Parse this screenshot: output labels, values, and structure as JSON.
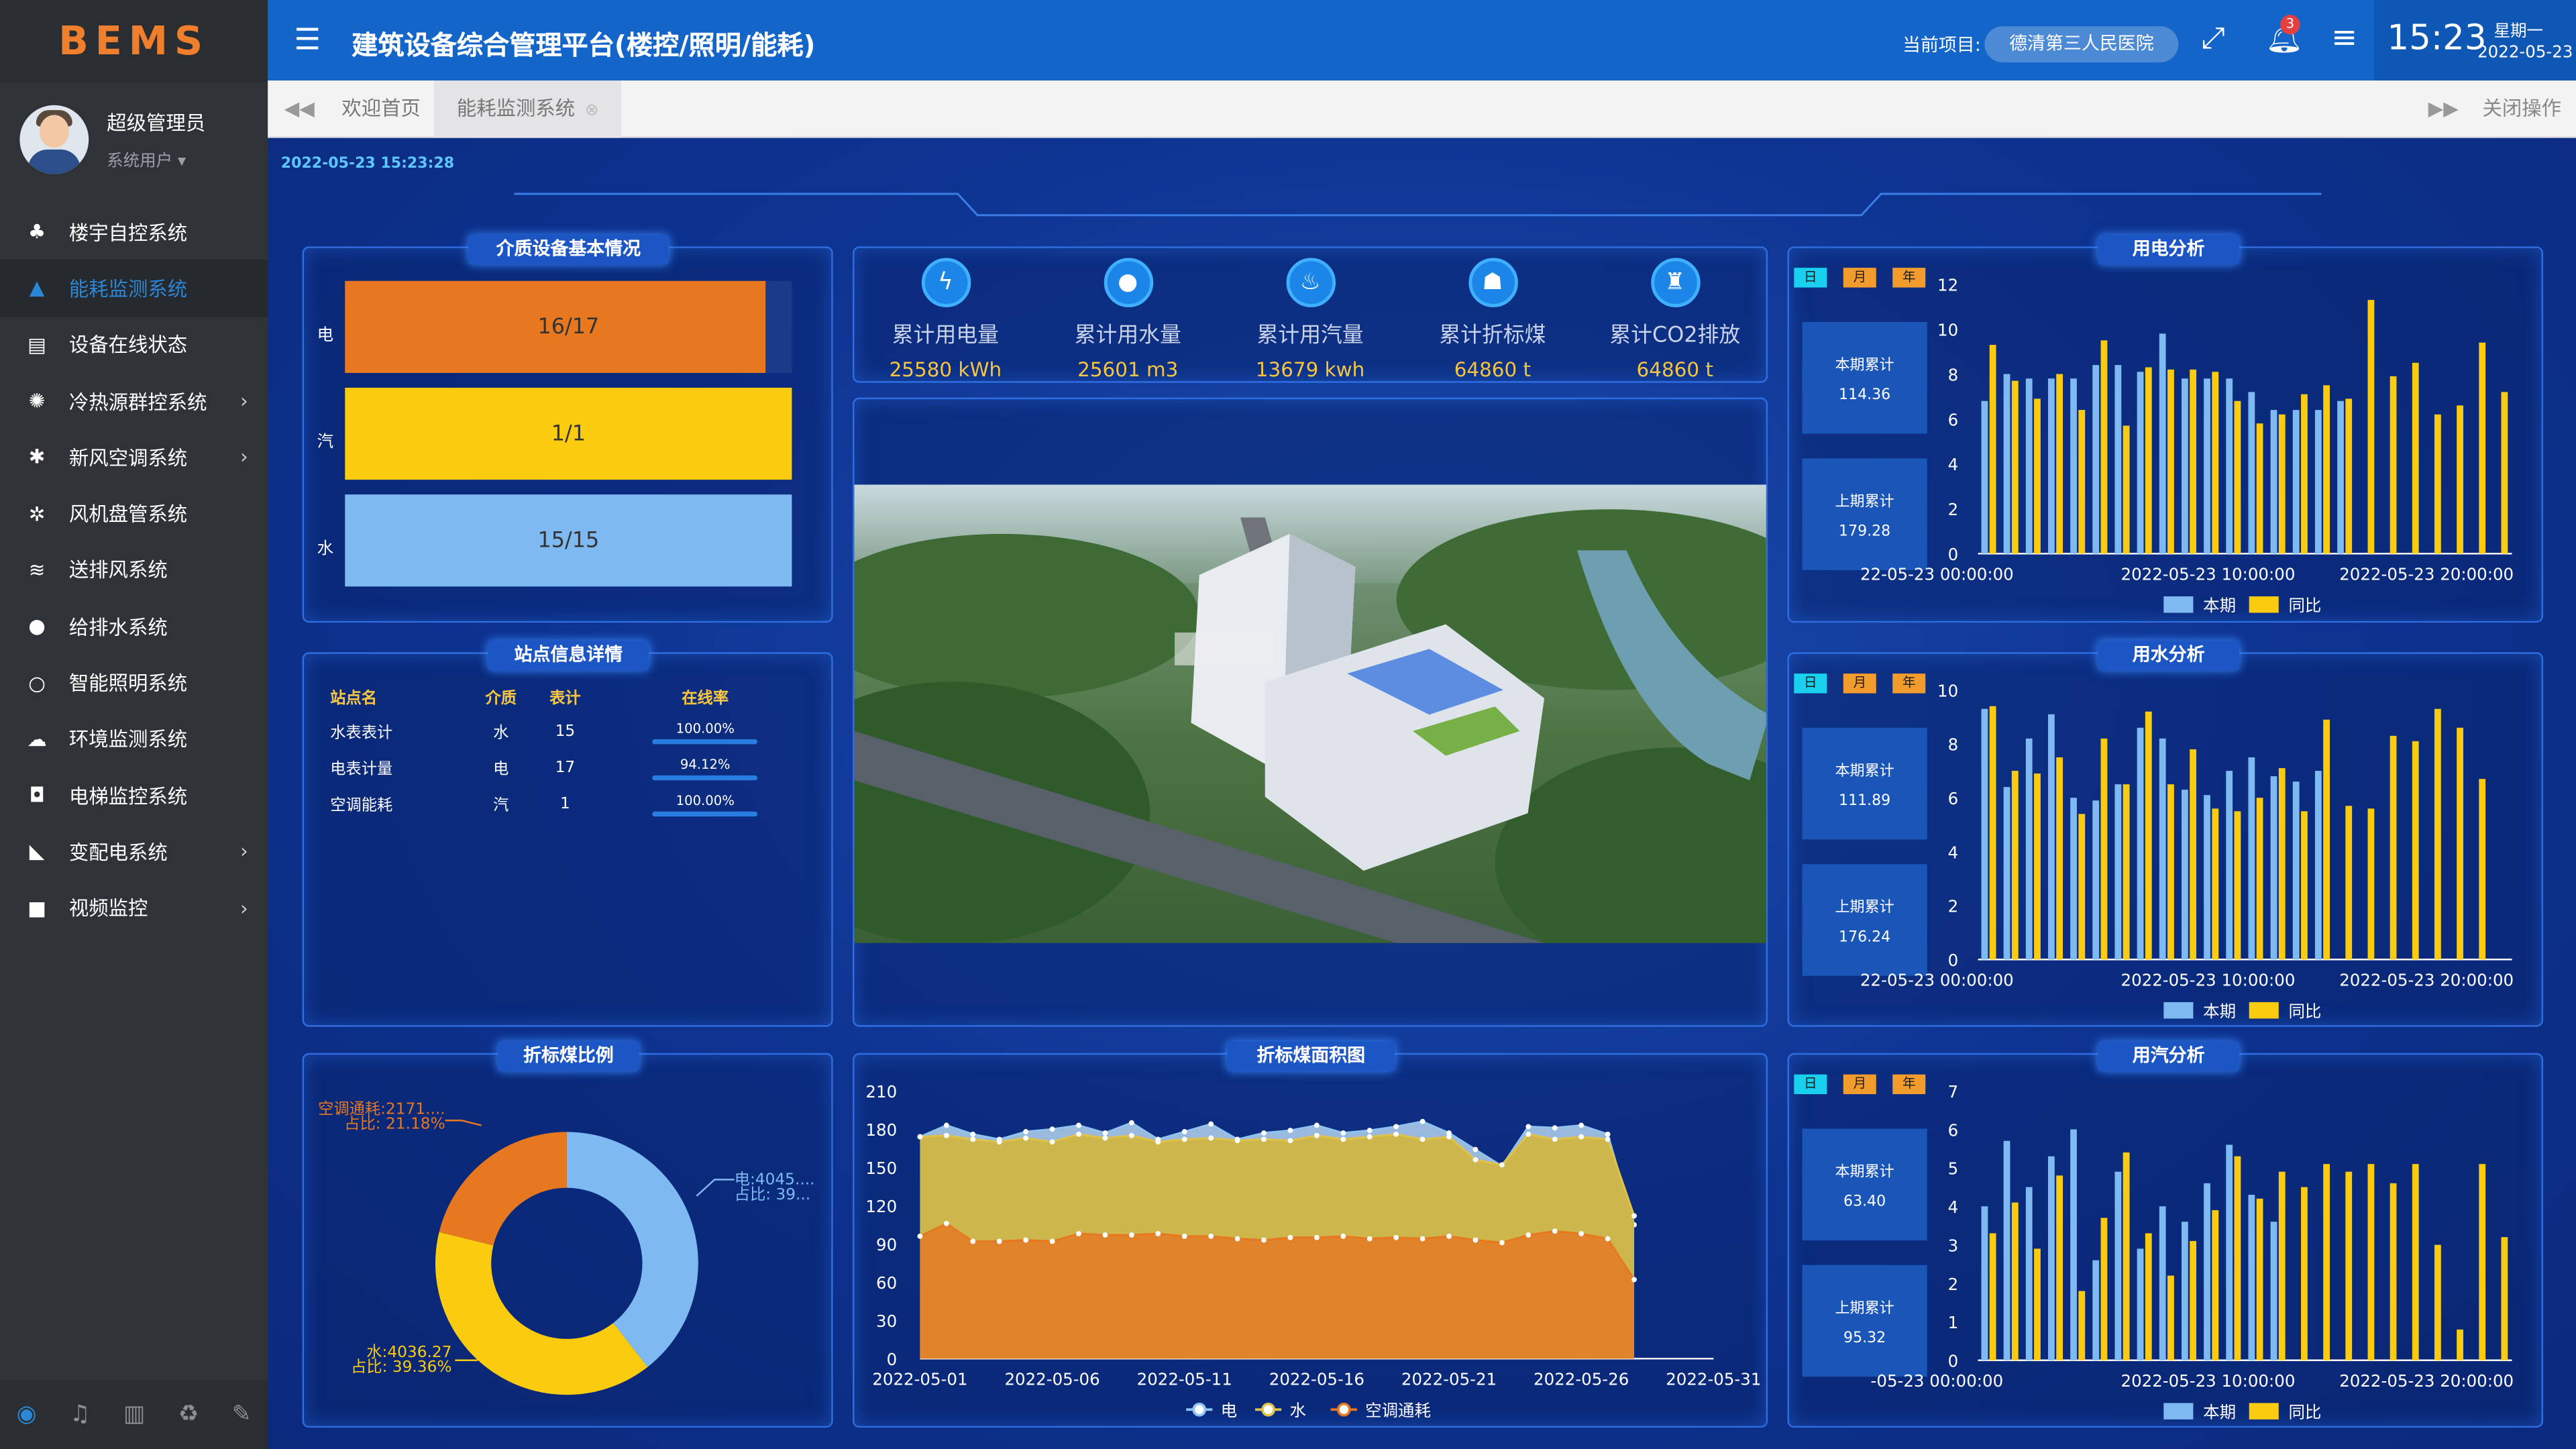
{
  "sidebar": {
    "logo": "BEMS",
    "user_name": "超级管理员",
    "user_role": "系统用户 ▾",
    "items": [
      {
        "label": "楼宇自控系统",
        "icon": "sitemap-icon"
      },
      {
        "label": "能耗监测系统",
        "icon": "area-chart-icon"
      },
      {
        "label": "设备在线状态",
        "icon": "document-icon"
      },
      {
        "label": "冷热源群控系统",
        "icon": "spinner-icon"
      },
      {
        "label": "新风空调系统",
        "icon": "snowflake-icon"
      },
      {
        "label": "风机盘管系统",
        "icon": "fan-icon"
      },
      {
        "label": "送排风系统",
        "icon": "wind-icon"
      },
      {
        "label": "给排水系统",
        "icon": "drop-icon"
      },
      {
        "label": "智能照明系统",
        "icon": "circle-icon"
      },
      {
        "label": "环境监测系统",
        "icon": "cloud-icon"
      },
      {
        "label": "电梯监控系统",
        "icon": "elevator-icon"
      },
      {
        "label": "变配电系统",
        "icon": "line-chart-icon"
      },
      {
        "label": "视频监控",
        "icon": "video-icon"
      }
    ]
  },
  "topbar": {
    "title": "建筑设备综合管理平台(楼控/照明/能耗)",
    "project_label": "当前项目:",
    "project": "德清第三人民医院",
    "badge": "3",
    "time": "15:23",
    "weekday": "星期一",
    "date": "2022-05-23"
  },
  "tabs": {
    "home": "欢迎首页",
    "current": "能耗监测系统",
    "close_ops": "关闭操作"
  },
  "dashboard": {
    "datetime": "2022-05-23 15:23:28",
    "medium": {
      "title": "介质设备基本情况",
      "rows": [
        {
          "label": "电",
          "text": "16/17",
          "ratio": 0.941,
          "color": "#e8781f"
        },
        {
          "label": "汽",
          "text": "1/1",
          "ratio": 1.0,
          "color": "#fbcb10"
        },
        {
          "label": "水",
          "text": "15/15",
          "ratio": 1.0,
          "color": "#7fb9f2"
        }
      ]
    },
    "station": {
      "title": "站点信息详情",
      "headers": [
        "站点名",
        "介质",
        "表计",
        "在线率"
      ],
      "rows": [
        {
          "name": "水表表计",
          "medium": "水",
          "count": "15",
          "rate": "100.00%"
        },
        {
          "name": "电表计量",
          "medium": "电",
          "count": "17",
          "rate": "94.12%"
        },
        {
          "name": "空调能耗",
          "medium": "汽",
          "count": "1",
          "rate": "100.00%"
        }
      ]
    },
    "stats": [
      {
        "label": "累计用电量",
        "value": "25580 kWh",
        "icon": "lightning-icon"
      },
      {
        "label": "累计用水量",
        "value": "25601 m3",
        "icon": "water-drop-icon"
      },
      {
        "label": "累计用汽量",
        "value": "13679 kwh",
        "icon": "flame-icon"
      },
      {
        "label": "累计折标煤",
        "value": "64860 t",
        "icon": "coal-icon"
      },
      {
        "label": "累计CO2排放",
        "value": "64860 t",
        "icon": "factory-icon"
      }
    ],
    "photo": {
      "name": "hospital-aerial-image"
    },
    "buttons": [
      "日",
      "月",
      "年"
    ],
    "legend": {
      "current": "本期",
      "yoy": "同比"
    },
    "elec": {
      "title": "用电分析",
      "cur_label": "本期累计",
      "cur_value": "114.36",
      "prev_label": "上期累计",
      "prev_value": "179.28"
    },
    "water": {
      "title": "用水分析",
      "cur_label": "本期累计",
      "cur_value": "111.89",
      "prev_label": "上期累计",
      "prev_value": "176.24"
    },
    "steam": {
      "title": "用汽分析",
      "cur_label": "本期累计",
      "cur_value": "63.40",
      "prev_label": "上期累计",
      "prev_value": "95.32"
    },
    "coal_ratio_title": "折标煤比例",
    "coal_area_title": "折标煤面积图"
  },
  "chart_data": [
    {
      "type": "bar",
      "title": "用电分析",
      "ylim": [
        0,
        12
      ],
      "yticks": [
        0,
        2,
        4,
        6,
        8,
        10,
        12
      ],
      "xlabels": [
        "22-05-23 00:00:00",
        "2022-05-23 10:00:00",
        "2022-05-23 20:00:00"
      ],
      "series": [
        {
          "name": "本期",
          "color": "#7fb9f2",
          "values": [
            6.8,
            8,
            7.8,
            7.8,
            7.8,
            8.4,
            8.4,
            8.1,
            9.8,
            7.8,
            7.8,
            7.8,
            7.2,
            6.4,
            6.4,
            6.4,
            6.8,
            0,
            0,
            0,
            0,
            0,
            0,
            0
          ]
        },
        {
          "name": "同比",
          "color": "#fbcb10",
          "values": [
            9.3,
            7.7,
            6.9,
            8,
            6.4,
            9.5,
            5.7,
            8.3,
            8.2,
            8.2,
            8.1,
            6.8,
            5.8,
            6.2,
            7.1,
            7.5,
            6.9,
            11.3,
            7.9,
            8.5,
            6.2,
            6.6,
            9.4,
            7.2
          ]
        }
      ]
    },
    {
      "type": "bar",
      "title": "用水分析",
      "ylim": [
        0,
        10
      ],
      "yticks": [
        0,
        2,
        4,
        6,
        8,
        10
      ],
      "xlabels": [
        "22-05-23 00:00:00",
        "2022-05-23 10:00:00",
        "2022-05-23 20:00:00"
      ],
      "series": [
        {
          "name": "本期",
          "color": "#7fb9f2",
          "values": [
            9.3,
            6.4,
            8.2,
            9.1,
            6,
            5.9,
            6.5,
            8.6,
            8.2,
            6.3,
            6.1,
            7,
            7.5,
            6.8,
            6.6,
            7,
            0,
            0,
            0,
            0,
            0,
            0,
            0,
            0
          ]
        },
        {
          "name": "同比",
          "color": "#fbcb10",
          "values": [
            9.4,
            7,
            6.9,
            7.5,
            5.4,
            8.2,
            6.5,
            9.2,
            6.5,
            7.8,
            5.6,
            5.5,
            6,
            7.1,
            5.5,
            8.9,
            5.7,
            5.6,
            8.3,
            8.1,
            9.3,
            8.6,
            6.7,
            0
          ]
        }
      ]
    },
    {
      "type": "bar",
      "title": "用汽分析",
      "ylim": [
        0,
        7
      ],
      "yticks": [
        0,
        1,
        2,
        3,
        4,
        5,
        6,
        7
      ],
      "xlabels": [
        "-05-23 00:00:00",
        "2022-05-23 10:00:00",
        "2022-05-23 20:00:00"
      ],
      "series": [
        {
          "name": "本期",
          "color": "#7fb9f2",
          "values": [
            4,
            5.7,
            4.5,
            5.3,
            6,
            2.6,
            4.9,
            2.9,
            4,
            3.6,
            4.6,
            5.6,
            4.3,
            3.6,
            0,
            0,
            0,
            0,
            0,
            0,
            0,
            0,
            0,
            0
          ]
        },
        {
          "name": "同比",
          "color": "#fbcb10",
          "values": [
            3.3,
            4.1,
            2.9,
            4.8,
            1.8,
            3.7,
            5.4,
            3.3,
            2.2,
            3.1,
            3.9,
            5.3,
            4.2,
            4.9,
            4.5,
            5.1,
            4.9,
            5.1,
            4.6,
            5.1,
            3,
            0.8,
            5.1,
            3.2
          ]
        }
      ]
    },
    {
      "type": "pie",
      "title": "折标煤比例",
      "slices": [
        {
          "name": "电",
          "value": 4045.0,
          "label": "电:4045....",
          "pct_label": "占比: 39...",
          "color": "#7fb9f2"
        },
        {
          "name": "水",
          "value": 4036.27,
          "label": "水:4036.27",
          "pct_label": "占比: 39.36%",
          "color": "#fbcb10"
        },
        {
          "name": "空调通耗",
          "value": 2171.0,
          "label": "空调通耗:2171....",
          "pct_label": "占比: 21.18%",
          "color": "#e8781f"
        }
      ]
    },
    {
      "type": "area",
      "title": "折标煤面积图",
      "ylim": [
        0,
        210
      ],
      "yticks": [
        0,
        30,
        60,
        90,
        120,
        150,
        180,
        210
      ],
      "xlabels": [
        "2022-05-01",
        "2022-05-06",
        "2022-05-11",
        "2022-05-16",
        "2022-05-21",
        "2022-05-26",
        "2022-05-31"
      ],
      "series": [
        {
          "name": "电",
          "color": "#8fc3f0",
          "values": [
            174,
            183,
            176,
            172,
            178,
            180,
            183,
            177,
            185,
            172,
            178,
            184,
            172,
            177,
            179,
            183,
            177,
            179,
            182,
            186,
            177,
            164,
            151,
            182,
            181,
            183,
            176,
            105,
            null,
            null,
            null
          ]
        },
        {
          "name": "水",
          "color": "#e0c24a",
          "values": [
            174,
            175,
            172,
            170,
            173,
            170,
            176,
            173,
            175,
            170,
            172,
            173,
            171,
            172,
            171,
            175,
            172,
            174,
            176,
            172,
            174,
            156,
            152,
            176,
            172,
            174,
            172,
            112,
            null,
            null,
            null
          ]
        },
        {
          "name": "空调通耗",
          "color": "#e8781f",
          "values": [
            96,
            106,
            92,
            92,
            93,
            92,
            98,
            97,
            97,
            98,
            96,
            96,
            94,
            93,
            95,
            95,
            96,
            94,
            95,
            94,
            96,
            93,
            91,
            97,
            100,
            98,
            94,
            62,
            null,
            null,
            null
          ]
        }
      ]
    }
  ]
}
